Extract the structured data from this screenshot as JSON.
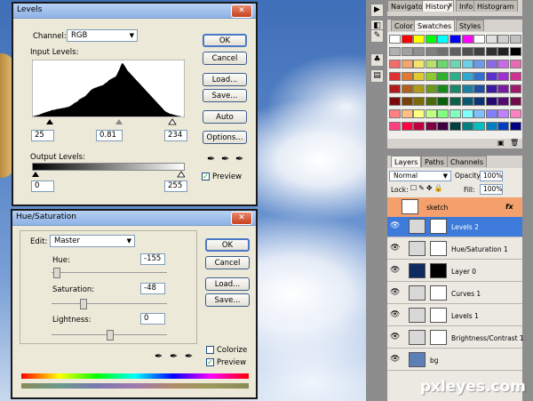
{
  "levels": {
    "title": "Levels",
    "channel_label": "Channel:",
    "channel_value": "RGB",
    "input_levels_label": "Input Levels:",
    "input_low": "25",
    "input_mid": "0.81",
    "input_high": "234",
    "output_levels_label": "Output Levels:",
    "output_low": "0",
    "output_high": "255",
    "buttons": {
      "ok": "OK",
      "cancel": "Cancel",
      "load": "Load...",
      "save": "Save...",
      "auto": "Auto",
      "options": "Options..."
    },
    "preview_label": "Preview"
  },
  "hue_sat": {
    "title": "Hue/Saturation",
    "edit_label": "Edit:",
    "edit_value": "Master",
    "hue_label": "Hue:",
    "hue_value": "-155",
    "saturation_label": "Saturation:",
    "saturation_value": "-48",
    "lightness_label": "Lightness:",
    "lightness_value": "0",
    "buttons": {
      "ok": "OK",
      "cancel": "Cancel",
      "load": "Load...",
      "save": "Save..."
    },
    "colorize_label": "Colorize",
    "preview_label": "Preview"
  },
  "top_panel": {
    "tabs": [
      "Navigator",
      "History",
      "Info",
      "Histogram"
    ],
    "close_glyph": "✕"
  },
  "swatches_panel": {
    "tabs": [
      "Color",
      "Swatches",
      "Styles"
    ],
    "colors": [
      [
        "#ffffff",
        "#ff0000",
        "#ffff00",
        "#00ff00",
        "#00ffff",
        "#0000ff",
        "#ff00ff",
        "#ffffff",
        "#e0e0e0",
        "#d0d0d0",
        "#c0c0c0"
      ],
      [
        "#b0b0b0",
        "#a0a0a0",
        "#909090",
        "#808080",
        "#707070",
        "#606060",
        "#505050",
        "#404040",
        "#303030",
        "#202020",
        "#000000"
      ],
      [
        "#f26b6b",
        "#f3a56b",
        "#f5e46b",
        "#b7e06b",
        "#6bd66b",
        "#6bd6b0",
        "#6bd0e6",
        "#6b9be6",
        "#8a6be6",
        "#c96be6",
        "#e66bb0"
      ],
      [
        "#e03030",
        "#e07a30",
        "#e0c830",
        "#90c830",
        "#30b030",
        "#30b08a",
        "#30a8d0",
        "#3070d0",
        "#5a30d0",
        "#a030d0",
        "#d03090"
      ],
      [
        "#b01a1a",
        "#b0601a",
        "#b09a1a",
        "#6a981a",
        "#1a881a",
        "#1a886a",
        "#1a80a0",
        "#1a50a0",
        "#3a1aa0",
        "#7a1aa0",
        "#a01a6a"
      ],
      [
        "#7a0a0a",
        "#7a400a",
        "#7a6a0a",
        "#4a6a0a",
        "#0a5e0a",
        "#0a5e4a",
        "#0a5870",
        "#0a3470",
        "#240a70",
        "#540a70",
        "#700a48"
      ],
      [
        "#ff8080",
        "#ffc080",
        "#ffff80",
        "#c0ff80",
        "#80ff80",
        "#80ffc0",
        "#80ffff",
        "#80c0ff",
        "#8080ff",
        "#c080ff",
        "#ff80c0"
      ],
      [
        "#ff4080",
        "#ff0040",
        "#c00040",
        "#800040",
        "#400040",
        "#004040",
        "#008080",
        "#00c0c0",
        "#0080c0",
        "#0040c0",
        "#000080"
      ]
    ]
  },
  "layers_panel": {
    "tabs": [
      "Layers",
      "Paths",
      "Channels"
    ],
    "blend_mode": "Normal",
    "opacity_label": "Opacity:",
    "opacity_value": "100%",
    "lock_label": "Lock:",
    "fill_label": "Fill:",
    "fill_value": "100%",
    "group_name": "sketch",
    "fx_label": "fx",
    "layers": [
      {
        "name": "Levels 2",
        "active": true
      },
      {
        "name": "Hue/Saturation 1",
        "active": false
      },
      {
        "name": "Layer 0",
        "active": false
      },
      {
        "name": "Curves 1",
        "active": false
      },
      {
        "name": "Levels 1",
        "active": false
      },
      {
        "name": "Brightness/Contrast 1",
        "active": false
      },
      {
        "name": "bg",
        "active": false
      }
    ]
  },
  "watermark": "pxleyes.com",
  "histogram": [
    0,
    0,
    1,
    1,
    2,
    2,
    3,
    3,
    4,
    5,
    5,
    6,
    7,
    7,
    8,
    9,
    9,
    10,
    10,
    11,
    12,
    12,
    12,
    13,
    13,
    14,
    14,
    14,
    15,
    15,
    15,
    16,
    16,
    16,
    17,
    17,
    18,
    18,
    19,
    20,
    21,
    22,
    24,
    25,
    26,
    27,
    28,
    30,
    32,
    33,
    34,
    35,
    36,
    37,
    38,
    40,
    42,
    44,
    46,
    48,
    50,
    51,
    52,
    53,
    54,
    54,
    55,
    56,
    56,
    57,
    58,
    58,
    59,
    60,
    62,
    63,
    64,
    66,
    68,
    69,
    70,
    71,
    72,
    73,
    74,
    75,
    78,
    82,
    86,
    90,
    95,
    99,
    100,
    98,
    95,
    92,
    89,
    86,
    84,
    82,
    80,
    78,
    76,
    74,
    72,
    70,
    68,
    66,
    64,
    62,
    60,
    58,
    56,
    54,
    52,
    50,
    48,
    46,
    44,
    42,
    40,
    38,
    36,
    34,
    32,
    30,
    28,
    26,
    24,
    22,
    20,
    18,
    16,
    14,
    12,
    10,
    9,
    8,
    7,
    6,
    5,
    5,
    4,
    4,
    3,
    3,
    2,
    2,
    1,
    1,
    1,
    0,
    0,
    0,
    0,
    0
  ]
}
